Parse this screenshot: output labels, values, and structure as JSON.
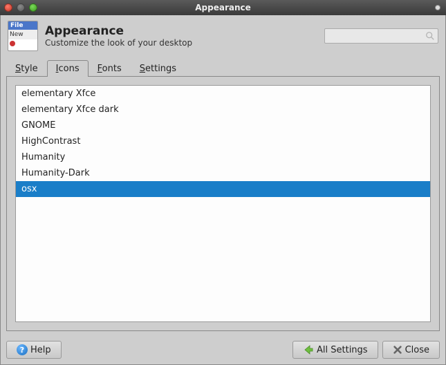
{
  "window": {
    "title": "Appearance"
  },
  "header": {
    "icon_labels": {
      "top": "File",
      "mid": "New"
    },
    "title": "Appearance",
    "subtitle": "Customize the look of your desktop"
  },
  "search": {
    "placeholder": ""
  },
  "tabs": [
    {
      "label": "Style",
      "accel_index": 0,
      "active": false
    },
    {
      "label": "Icons",
      "accel_index": 0,
      "active": true
    },
    {
      "label": "Fonts",
      "accel_index": 0,
      "active": false
    },
    {
      "label": "Settings",
      "accel_index": 0,
      "active": false
    }
  ],
  "icon_themes": [
    {
      "name": "elementary Xfce",
      "selected": false
    },
    {
      "name": "elementary Xfce dark",
      "selected": false
    },
    {
      "name": "GNOME",
      "selected": false
    },
    {
      "name": "HighContrast",
      "selected": false
    },
    {
      "name": "Humanity",
      "selected": false
    },
    {
      "name": "Humanity-Dark",
      "selected": false
    },
    {
      "name": "osx",
      "selected": true
    }
  ],
  "footer": {
    "help_label": "Help",
    "all_settings_label": "All Settings",
    "close_label": "Close"
  }
}
